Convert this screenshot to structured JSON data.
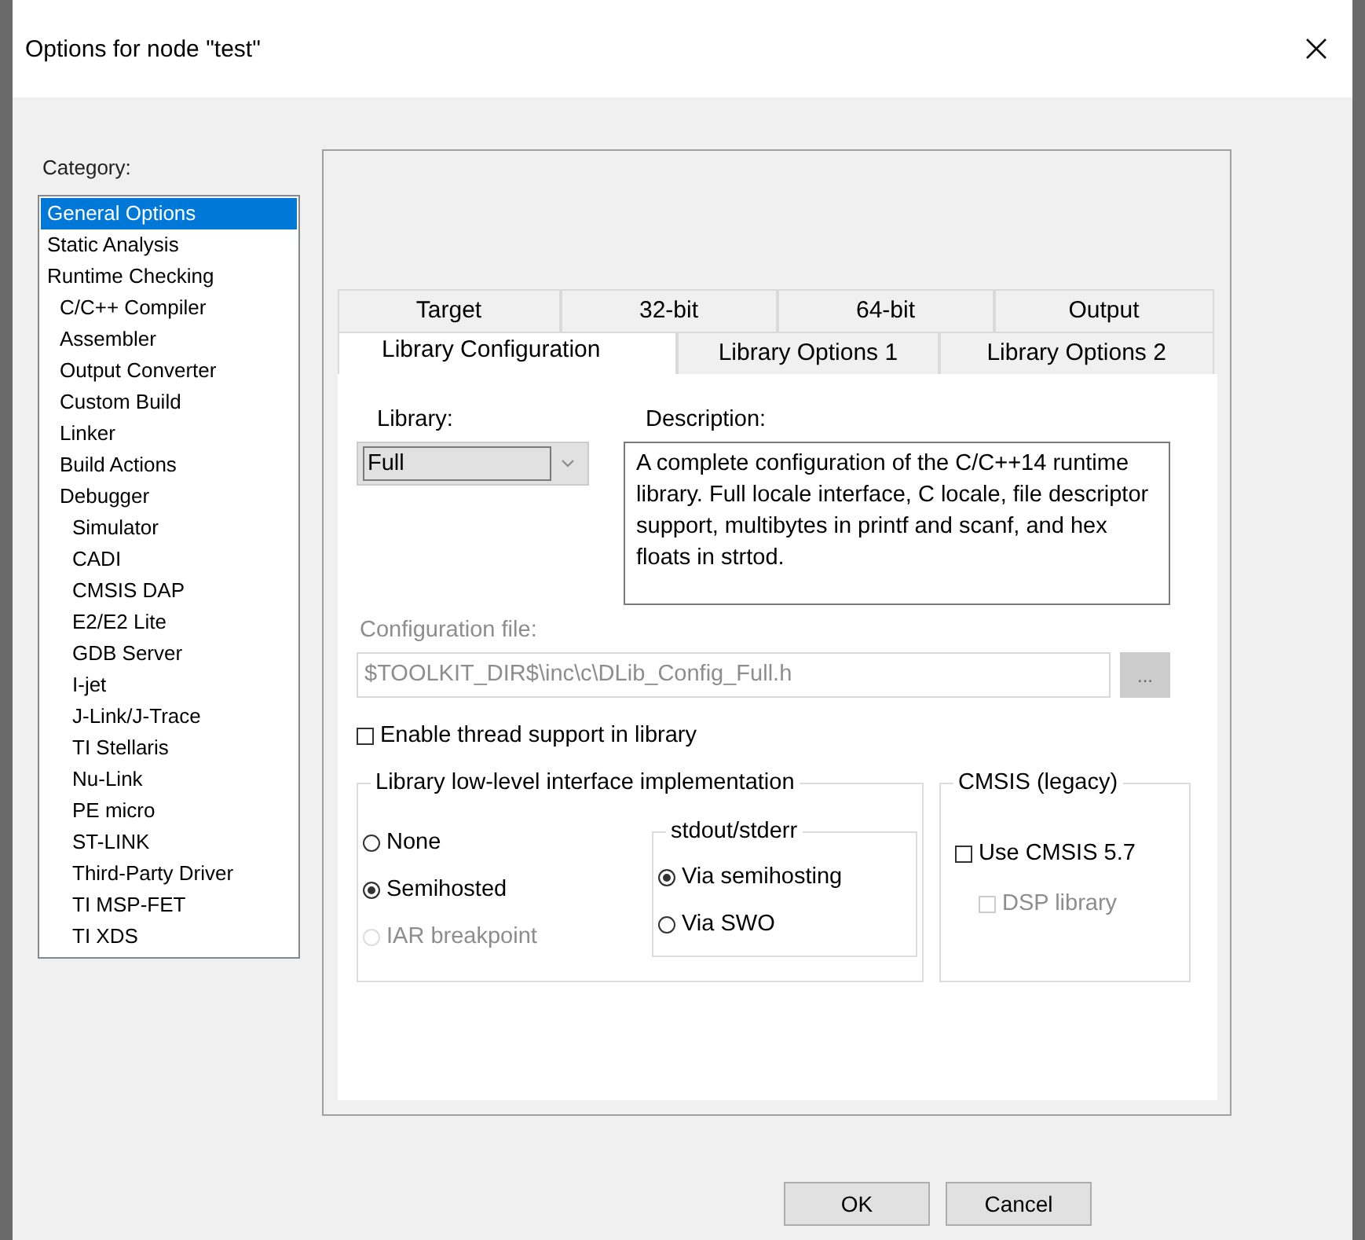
{
  "window": {
    "title": "Options for node \"test\""
  },
  "category": {
    "label": "Category:",
    "items": [
      {
        "label": "General Options",
        "selected": true
      },
      {
        "label": "Static Analysis",
        "selected": false
      },
      {
        "label": "Runtime Checking",
        "selected": false,
        "children": [
          {
            "label": "C/C++ Compiler",
            "selected": false
          },
          {
            "label": "Assembler",
            "selected": false
          },
          {
            "label": "Output Converter",
            "selected": false
          },
          {
            "label": "Custom Build",
            "selected": false
          },
          {
            "label": "Linker",
            "selected": false
          },
          {
            "label": "Build Actions",
            "selected": false
          },
          {
            "label": "Debugger",
            "selected": false,
            "children": [
              {
                "label": "Simulator",
                "selected": false
              },
              {
                "label": "CADI",
                "selected": false
              },
              {
                "label": "CMSIS DAP",
                "selected": false
              },
              {
                "label": "E2/E2 Lite",
                "selected": false
              },
              {
                "label": "GDB Server",
                "selected": false
              },
              {
                "label": "I-jet",
                "selected": false
              },
              {
                "label": "J-Link/J-Trace",
                "selected": false
              },
              {
                "label": "TI Stellaris",
                "selected": false
              },
              {
                "label": "Nu-Link",
                "selected": false
              },
              {
                "label": "PE micro",
                "selected": false
              },
              {
                "label": "ST-LINK",
                "selected": false
              },
              {
                "label": "Third-Party Driver",
                "selected": false
              },
              {
                "label": "TI MSP-FET",
                "selected": false
              },
              {
                "label": "TI XDS",
                "selected": false
              }
            ]
          }
        ]
      }
    ]
  },
  "tab_rows": [
    [
      {
        "label": "Target",
        "selected": false
      },
      {
        "label": "32-bit",
        "selected": false
      },
      {
        "label": "64-bit",
        "selected": false
      },
      {
        "label": "Output",
        "selected": false
      }
    ],
    [
      {
        "label": "Library Configuration",
        "selected": true
      },
      {
        "label": "Library Options 1",
        "selected": false
      },
      {
        "label": "Library Options 2",
        "selected": false
      }
    ]
  ],
  "library": {
    "label": "Library:",
    "value": "Full"
  },
  "description": {
    "label": "Description:",
    "text": "A complete configuration of the C/C++14 runtime library. Full locale interface, C locale, file descriptor support, multibytes in printf and scanf, and hex floats in strtod."
  },
  "config_file": {
    "label": "Configuration file:",
    "value": "$TOOLKIT_DIR$\\inc\\c\\DLib_Config_Full.h",
    "browse": "...",
    "disabled": true
  },
  "thread_support": {
    "label": "Enable thread support in library",
    "checked": false
  },
  "low_level": {
    "title": "Library low-level interface implementation",
    "options": [
      {
        "label": "None",
        "selected": false,
        "disabled": false
      },
      {
        "label": "Semihosted",
        "selected": true,
        "disabled": false
      },
      {
        "label": "IAR breakpoint",
        "selected": false,
        "disabled": true
      }
    ]
  },
  "stdout": {
    "title": "stdout/stderr",
    "options": [
      {
        "label": "Via semihosting",
        "selected": true,
        "disabled": false
      },
      {
        "label": "Via SWO",
        "selected": false,
        "disabled": false
      }
    ]
  },
  "cmsis": {
    "title": "CMSIS (legacy)",
    "options": [
      {
        "label": "Use CMSIS 5.7",
        "checked": false,
        "disabled": false
      },
      {
        "label": "DSP library",
        "checked": false,
        "disabled": true
      }
    ]
  },
  "buttons": [
    "OK",
    "Cancel"
  ]
}
